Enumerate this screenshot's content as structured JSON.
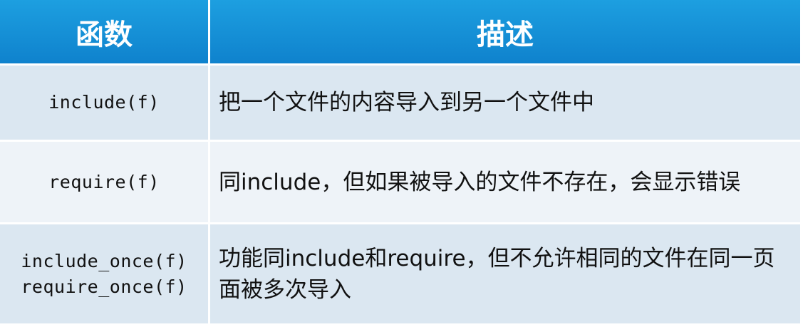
{
  "table": {
    "headers": {
      "function": "函数",
      "description": "描述"
    },
    "rows": [
      {
        "functions": [
          "include(f)"
        ],
        "description": "把一个文件的内容导入到另一个文件中"
      },
      {
        "functions": [
          "require(f)"
        ],
        "description": "同include，但如果被导入的文件不存在，会显示错误"
      },
      {
        "functions": [
          "include_once(f)",
          "require_once(f)"
        ],
        "description": "功能同include和require，但不允许相同的文件在同一页面被多次导入"
      }
    ]
  },
  "colors": {
    "header_bg": "#1591d6",
    "header_text": "#ffffff",
    "row_dark": "#dbe7f1",
    "row_light": "#eef3f8"
  }
}
